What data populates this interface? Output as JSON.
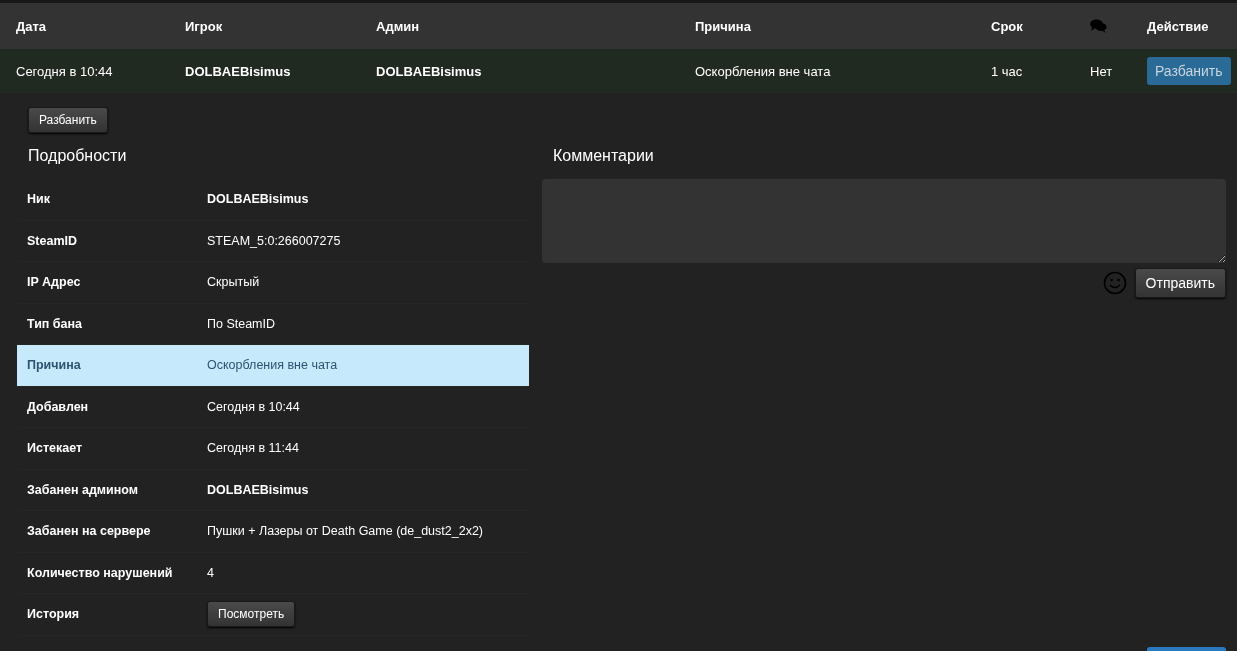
{
  "table": {
    "columns": [
      {
        "kind": "text",
        "label": "Дата"
      },
      {
        "kind": "text",
        "label": "Игрок"
      },
      {
        "kind": "text",
        "label": "Админ"
      },
      {
        "kind": "text",
        "label": "Причина"
      },
      {
        "kind": "text",
        "label": "Срок"
      },
      {
        "kind": "icon"
      },
      {
        "kind": "text",
        "label": "Действие"
      }
    ],
    "rows": [
      {
        "cells": [
          {
            "kind": "text",
            "text": "Сегодня в 10:44"
          },
          {
            "kind": "name",
            "text": "DOLBAEBisimus"
          },
          {
            "kind": "name",
            "text": "DOLBAEBisimus"
          },
          {
            "kind": "text",
            "text": "Оскорбления вне чата"
          },
          {
            "kind": "text",
            "text": "1 час"
          },
          {
            "kind": "text",
            "text": "Нет"
          },
          {
            "kind": "button",
            "text": "Разбанить"
          }
        ]
      }
    ]
  },
  "unban_button": "Разбанить",
  "details": {
    "title": "Подробности",
    "rows": [
      {
        "label": "Ник",
        "value": "DOLBAEBisimus",
        "kind": "name",
        "selected": false
      },
      {
        "label": "SteamID",
        "value": "STEAM_5:0:266007275",
        "kind": "text",
        "selected": false
      },
      {
        "label": "IP Адрес",
        "value": "Скрытый",
        "kind": "text",
        "selected": false
      },
      {
        "label": "Тип бана",
        "value": "По SteamID",
        "kind": "text",
        "selected": false
      },
      {
        "label": "Причина",
        "value": "Оскорбления вне чата",
        "kind": "text",
        "selected": true
      },
      {
        "label": "Добавлен",
        "value": "Сегодня в 10:44",
        "kind": "text",
        "selected": false
      },
      {
        "label": "Истекает",
        "value": "Сегодня в 11:44",
        "kind": "text",
        "selected": false
      },
      {
        "label": "Забанен админом",
        "value": "DOLBAEBisimus",
        "kind": "name",
        "selected": false
      },
      {
        "label": "Забанен на сервере",
        "value": "Пушки + Лазеры от Death Game (de_dust2_2x2)",
        "kind": "text",
        "selected": false
      },
      {
        "label": "Количество нарушений",
        "value": "4",
        "kind": "text",
        "selected": false
      },
      {
        "label": "История",
        "value": "Посмотреть",
        "kind": "button",
        "selected": false
      }
    ]
  },
  "comments": {
    "title": "Комментарии",
    "send_button": "Отправить"
  }
}
